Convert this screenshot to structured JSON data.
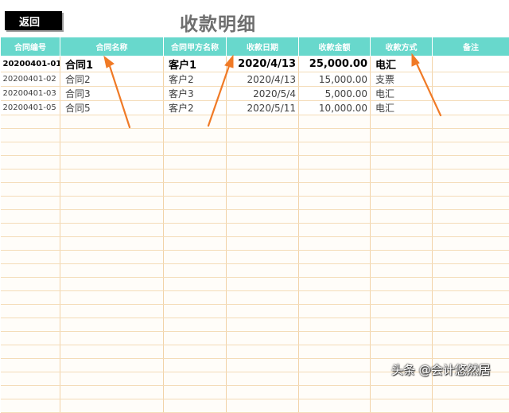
{
  "toolbar": {
    "back_label": "返回"
  },
  "page": {
    "title": "收款明细"
  },
  "table": {
    "headers": [
      "合同编号",
      "合同名称",
      "合同甲方名称",
      "收款日期",
      "收款金额",
      "收款方式",
      "备注"
    ],
    "rows": [
      [
        "20200401-01",
        "合同1",
        "客户1",
        "2020/4/13",
        "25,000.00",
        "电汇",
        ""
      ],
      [
        "20200401-02",
        "合同2",
        "客户2",
        "2020/4/13",
        "15,000.00",
        "支票",
        ""
      ],
      [
        "20200401-03",
        "合同3",
        "客户3",
        "2020/5/4",
        "5,000.00",
        "电汇",
        ""
      ],
      [
        "20200401-05",
        "合同5",
        "客户2",
        "2020/5/11",
        "10,000.00",
        "电汇",
        ""
      ]
    ]
  },
  "annotations": {
    "arrow_color": "#f07a26"
  },
  "watermark": {
    "text": "头条 @会计悠然居"
  }
}
